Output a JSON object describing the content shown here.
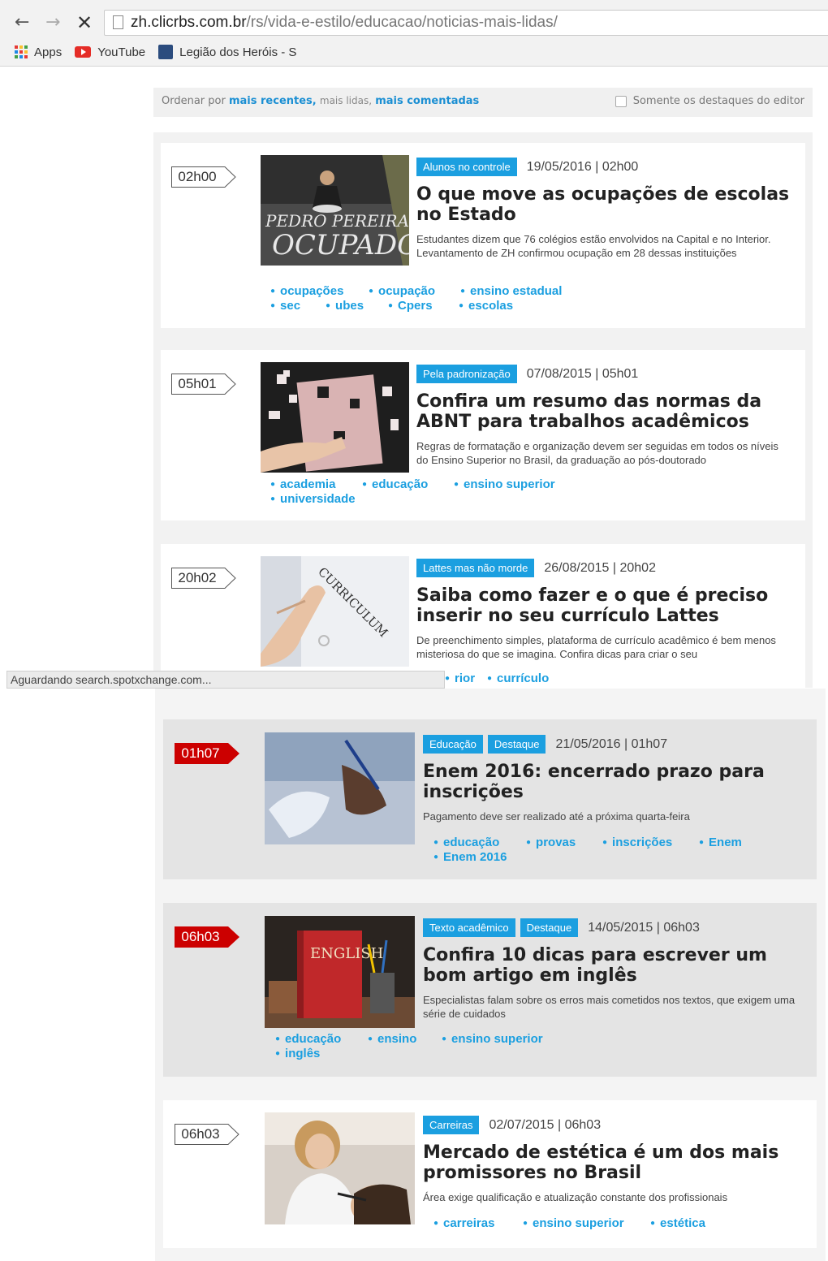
{
  "browser": {
    "url_host": "zh.clicrbs.com.br",
    "url_path": "/rs/vida-e-estilo/educacao/noticias-mais-lidas/",
    "bookmarks": [
      {
        "label": "Apps"
      },
      {
        "label": "YouTube"
      },
      {
        "label": "Legião dos Heróis - S"
      }
    ],
    "status": "Aguardando search.spotxchange.com..."
  },
  "sortbar": {
    "prefix": "Ordenar por",
    "recent": "mais recentes,",
    "read": "mais lidas,",
    "commented": "mais comentadas",
    "editor_only": "Somente os destaques do editor"
  },
  "articles": [
    {
      "time": "02h00",
      "tags": [
        "Alunos no controle"
      ],
      "date": "19/05/2016 | 02h00",
      "title": "O que move as ocupações de escolas no Estado",
      "desc": "Estudantes dizem que 76 colégios estão envolvidos na Capital e no Interior. Levantamento de ZH confirmou ocupação em 28 dessas instituições",
      "keywords": [
        "ocupações",
        "ocupação",
        "ensino estadual",
        "sec",
        "ubes",
        "Cpers",
        "escolas"
      ]
    },
    {
      "time": "05h01",
      "tags": [
        "Pela padronização"
      ],
      "date": "07/08/2015 | 05h01",
      "title": "Confira um resumo das normas da ABNT para trabalhos acadêmicos",
      "desc": "Regras de formatação e organização devem ser seguidas em todos os níveis do Ensino Superior no Brasil, da graduação ao pós-doutorado",
      "keywords": [
        "academia",
        "educação",
        "ensino superior",
        "universidade"
      ]
    },
    {
      "time": "20h02",
      "tags": [
        "Lattes mas não morde"
      ],
      "date": "26/08/2015 | 20h02",
      "title": "Saiba como fazer e o que é preciso inserir no seu currículo Lattes",
      "desc": "De preenchimento simples, plataforma de currículo acadêmico é bem menos misteriosa do que se imagina. Confira dicas para criar o seu",
      "keywords": [
        "rior",
        "currículo"
      ]
    },
    {
      "time": "01h07",
      "tags": [
        "Educação",
        "Destaque"
      ],
      "date": "21/05/2016 | 01h07",
      "title": "Enem 2016: encerrado prazo para inscrições",
      "desc": "Pagamento deve ser realizado até a próxima quarta-feira",
      "keywords": [
        "educação",
        "provas",
        "inscrições",
        "Enem",
        "Enem 2016"
      ]
    },
    {
      "time": "06h03",
      "tags": [
        "Texto acadêmico",
        "Destaque"
      ],
      "date": "14/05/2015 | 06h03",
      "title": "Confira 10 dicas para escrever um bom artigo em inglês",
      "desc": "Especialistas falam sobre os erros mais cometidos nos textos, que exigem uma série de cuidados",
      "keywords": [
        "educação",
        "ensino",
        "ensino superior",
        "inglês"
      ]
    },
    {
      "time": "06h03",
      "tags": [
        "Carreiras"
      ],
      "date": "02/07/2015 | 06h03",
      "title": "Mercado de estética é um dos mais promissores no Brasil",
      "desc": "Área exige qualificação e atualização constante dos profissionais",
      "keywords": [
        "carreiras",
        "ensino superior",
        "estética"
      ]
    }
  ],
  "thumb_text": {
    "a1_line1": "PEDRO PEREIRA",
    "a1_line2": "OCUPADO!",
    "a3_word": "CURRICULUM",
    "a5_book": "ENGLISH"
  },
  "colors": {
    "accent": "#1b9fe0",
    "badge_red": "#cc0000"
  }
}
